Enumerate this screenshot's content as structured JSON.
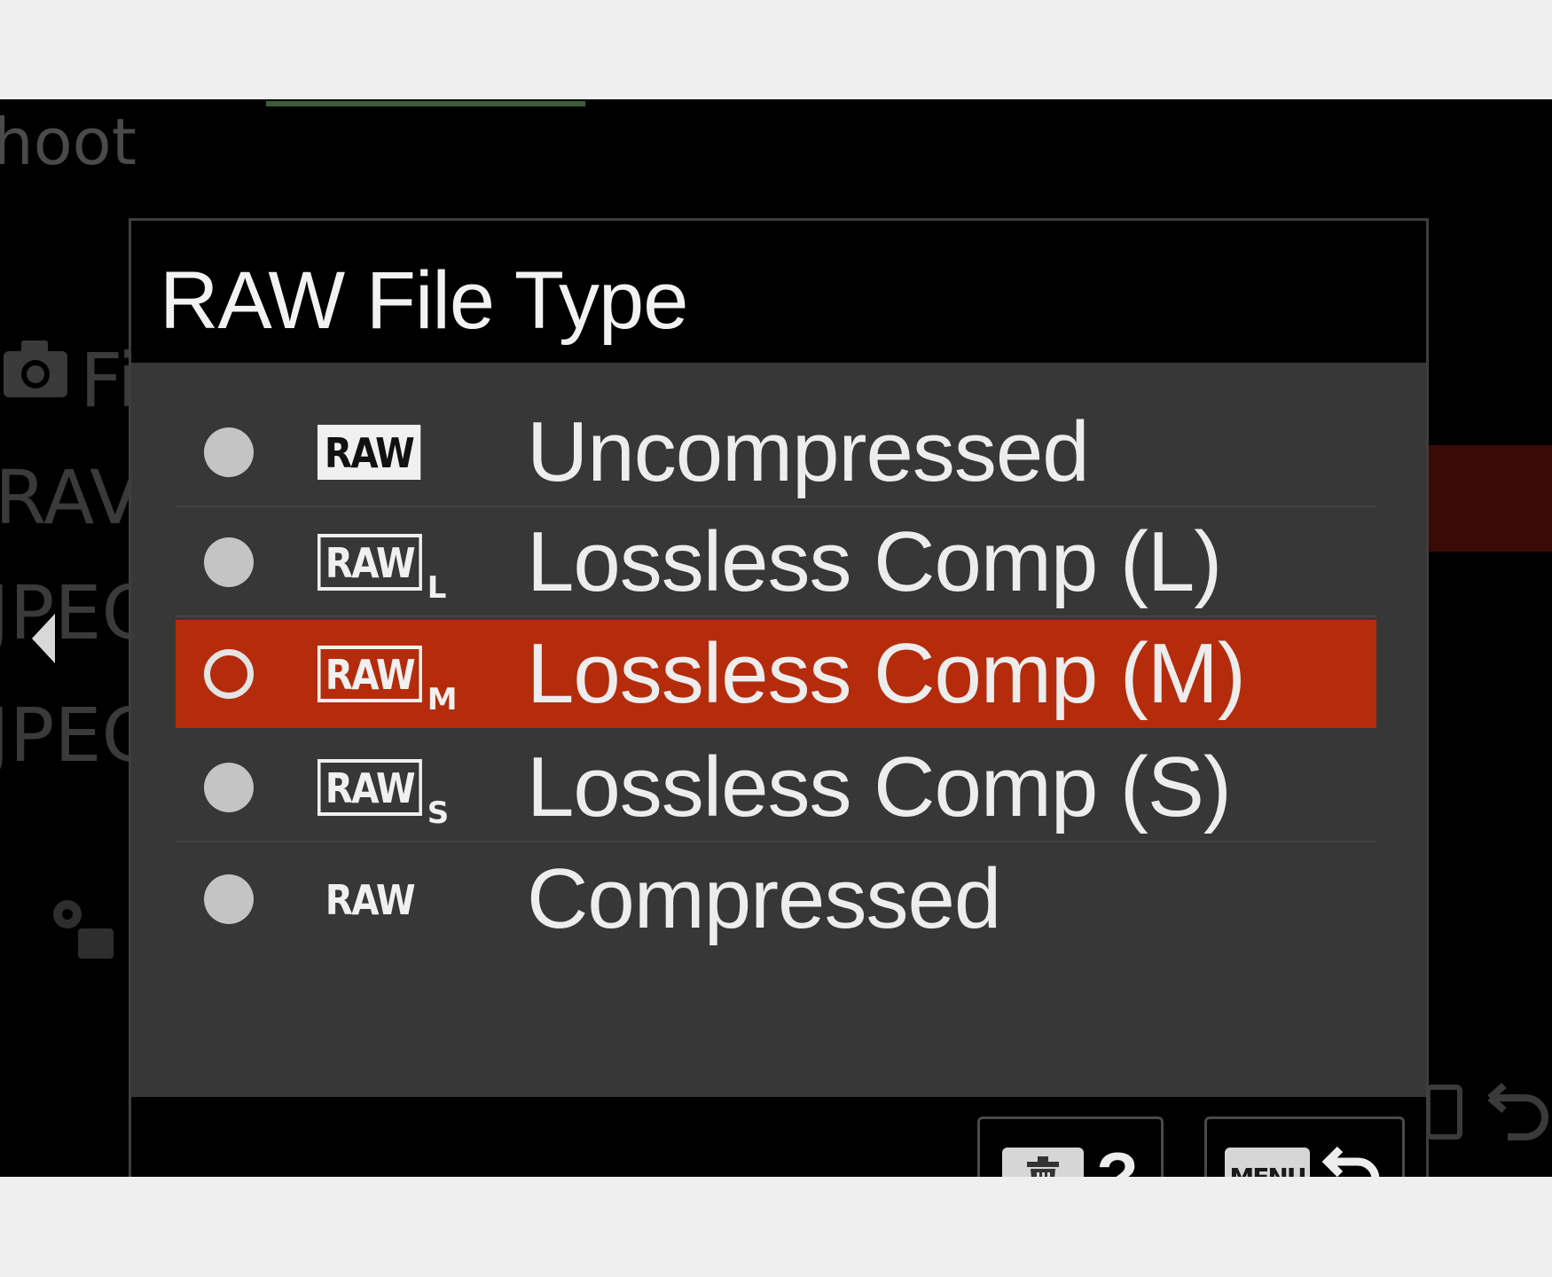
{
  "background_menu": {
    "category_partial": "hoot",
    "item1_partial": "Fi",
    "item2_partial": "RAV",
    "item3_partial": "JPEG",
    "item4_partial": "JPEG"
  },
  "dialog": {
    "title": "RAW File Type",
    "options": [
      {
        "badge": "RAW",
        "badge_style": "solid",
        "sub": "",
        "label": "Uncompressed",
        "selected": false
      },
      {
        "badge": "RAW",
        "badge_style": "outline",
        "sub": "L",
        "label": "Lossless Comp (L)",
        "selected": false
      },
      {
        "badge": "RAW",
        "badge_style": "outline",
        "sub": "M",
        "label": "Lossless Comp (M)",
        "selected": true
      },
      {
        "badge": "RAW",
        "badge_style": "outline",
        "sub": "S",
        "label": "Lossless Comp (S)",
        "selected": false
      },
      {
        "badge": "RAW",
        "badge_style": "plain",
        "sub": "",
        "label": "Compressed",
        "selected": false
      }
    ],
    "footer": {
      "help_symbol": "?",
      "help_key_icon": "trash-icon",
      "back_key": "MENU",
      "back_icon": "return-arrow-icon"
    }
  },
  "colors": {
    "selection": "#b52c0c",
    "list_bg": "#373737",
    "text": "#ededed"
  }
}
